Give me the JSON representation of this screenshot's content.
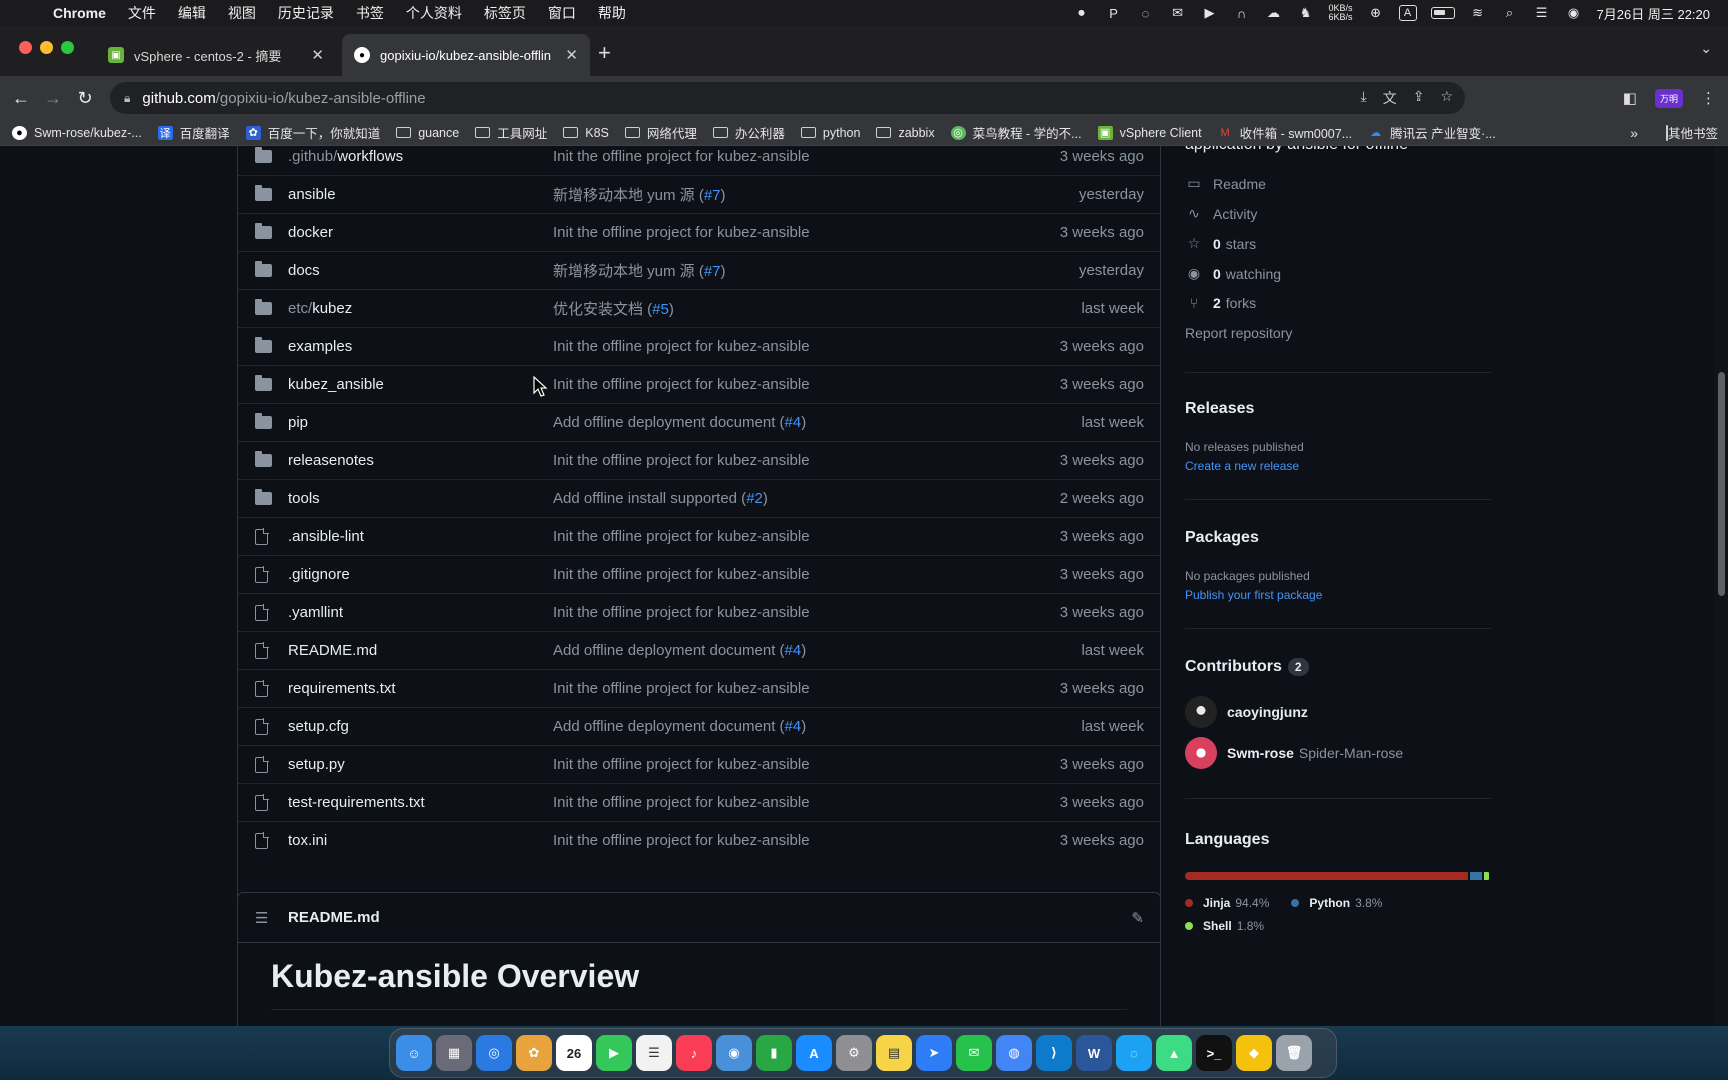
{
  "menubar": {
    "app_name": "Chrome",
    "menus": [
      "文件",
      "编辑",
      "视图",
      "历史记录",
      "书签",
      "个人资料",
      "标签页",
      "窗口",
      "帮助"
    ],
    "net_up": "0KB/s",
    "net_down": "6KB/s",
    "input_method": "A",
    "datetime": "7月26日 周三 22:20"
  },
  "tabs": [
    {
      "title": "vSphere - centos-2 - 摘要",
      "active": false
    },
    {
      "title": "gopixiu-io/kubez-ansible-offlin",
      "active": true
    }
  ],
  "omnibox": {
    "host": "github.com",
    "path": "/gopixiu-io/kubez-ansible-offline"
  },
  "profile_label": "万明",
  "bookmarks": [
    {
      "label": "Swm-rose/kubez-...",
      "icon": "github-icon"
    },
    {
      "label": "百度翻译",
      "icon": "translate-icon"
    },
    {
      "label": "百度一下，你就知道",
      "icon": "baidu-icon"
    },
    {
      "label": "guance",
      "icon": "folder-icon"
    },
    {
      "label": "工具网址",
      "icon": "folder-icon"
    },
    {
      "label": "K8S",
      "icon": "folder-icon"
    },
    {
      "label": "网络代理",
      "icon": "folder-icon"
    },
    {
      "label": "办公利器",
      "icon": "folder-icon"
    },
    {
      "label": "python",
      "icon": "folder-icon"
    },
    {
      "label": "zabbix",
      "icon": "folder-icon"
    },
    {
      "label": "菜鸟教程 - 学的不...",
      "icon": "runoob-icon"
    },
    {
      "label": "vSphere Client",
      "icon": "vsphere-icon"
    },
    {
      "label": "收件箱 - swm0007...",
      "icon": "gmail-icon"
    },
    {
      "label": "腾讯云 产业智变·...",
      "icon": "tencent-cloud-icon"
    }
  ],
  "bookmarks_more": "»",
  "bookmarks_other": "其他书签",
  "files": [
    {
      "type": "dir",
      "prefix": ".github/",
      "name": "workflows",
      "msg": "Init the offline project for kubez-ansible",
      "link": "",
      "time": "3 weeks ago"
    },
    {
      "type": "dir",
      "prefix": "",
      "name": "ansible",
      "msg": "新增移动本地 yum 源 (",
      "link": "#7",
      "time": "yesterday"
    },
    {
      "type": "dir",
      "prefix": "",
      "name": "docker",
      "msg": "Init the offline project for kubez-ansible",
      "link": "",
      "time": "3 weeks ago"
    },
    {
      "type": "dir",
      "prefix": "",
      "name": "docs",
      "msg": "新增移动本地 yum 源 (",
      "link": "#7",
      "time": "yesterday"
    },
    {
      "type": "dir",
      "prefix": "etc/",
      "name": "kubez",
      "msg": "优化安装文档 (",
      "link": "#5",
      "time": "last week"
    },
    {
      "type": "dir",
      "prefix": "",
      "name": "examples",
      "msg": "Init the offline project for kubez-ansible",
      "link": "",
      "time": "3 weeks ago"
    },
    {
      "type": "dir",
      "prefix": "",
      "name": "kubez_ansible",
      "msg": "Init the offline project for kubez-ansible",
      "link": "",
      "time": "3 weeks ago"
    },
    {
      "type": "dir",
      "prefix": "",
      "name": "pip",
      "msg": "Add offline deployment document (",
      "link": "#4",
      "time": "last week"
    },
    {
      "type": "dir",
      "prefix": "",
      "name": "releasenotes",
      "msg": "Init the offline project for kubez-ansible",
      "link": "",
      "time": "3 weeks ago"
    },
    {
      "type": "dir",
      "prefix": "",
      "name": "tools",
      "msg": "Add offline install supported (",
      "link": "#2",
      "time": "2 weeks ago"
    },
    {
      "type": "file",
      "prefix": "",
      "name": ".ansible-lint",
      "msg": "Init the offline project for kubez-ansible",
      "link": "",
      "time": "3 weeks ago"
    },
    {
      "type": "file",
      "prefix": "",
      "name": ".gitignore",
      "msg": "Init the offline project for kubez-ansible",
      "link": "",
      "time": "3 weeks ago"
    },
    {
      "type": "file",
      "prefix": "",
      "name": ".yamllint",
      "msg": "Init the offline project for kubez-ansible",
      "link": "",
      "time": "3 weeks ago"
    },
    {
      "type": "file",
      "prefix": "",
      "name": "README.md",
      "msg": "Add offline deployment document (",
      "link": "#4",
      "time": "last week"
    },
    {
      "type": "file",
      "prefix": "",
      "name": "requirements.txt",
      "msg": "Init the offline project for kubez-ansible",
      "link": "",
      "time": "3 weeks ago"
    },
    {
      "type": "file",
      "prefix": "",
      "name": "setup.cfg",
      "msg": "Add offline deployment document (",
      "link": "#4",
      "time": "last week"
    },
    {
      "type": "file",
      "prefix": "",
      "name": "setup.py",
      "msg": "Init the offline project for kubez-ansible",
      "link": "",
      "time": "3 weeks ago"
    },
    {
      "type": "file",
      "prefix": "",
      "name": "test-requirements.txt",
      "msg": "Init the offline project for kubez-ansible",
      "link": "",
      "time": "3 weeks ago"
    },
    {
      "type": "file",
      "prefix": "",
      "name": "tox.ini",
      "msg": "Init the offline project for kubez-ansible",
      "link": "",
      "time": "3 weeks ago"
    }
  ],
  "readme": {
    "file_label": "README.md",
    "heading": "Kubez-ansible Overview"
  },
  "sidebar": {
    "about_tail": "application by ansible for offline",
    "readme": "Readme",
    "activity": "Activity",
    "stars_count": "0",
    "stars_label": "stars",
    "watching_count": "0",
    "watching_label": "watching",
    "forks_count": "2",
    "forks_label": "forks",
    "report": "Report repository",
    "releases_title": "Releases",
    "releases_empty": "No releases published",
    "releases_link": "Create a new release",
    "packages_title": "Packages",
    "packages_empty": "No packages published",
    "packages_link": "Publish your first package",
    "contributors_title": "Contributors",
    "contributors_count": "2",
    "contributors": [
      {
        "login": "caoyingjunz",
        "alias": ""
      },
      {
        "login": "Swm-rose",
        "alias": "Spider-Man-rose"
      }
    ],
    "languages_title": "Languages",
    "languages": [
      {
        "name": "Jinja",
        "pct": "94.4%",
        "value": 94.4,
        "color": "#a52a22"
      },
      {
        "name": "Python",
        "pct": "3.8%",
        "value": 3.8,
        "color": "#3572A5"
      },
      {
        "name": "Shell",
        "pct": "1.8%",
        "value": 1.8,
        "color": "#89e051"
      }
    ]
  },
  "dock_apps": [
    "finder",
    "launchpad",
    "safari",
    "photos",
    "calendar",
    "facetime",
    "reminders",
    "music",
    "qq-cat",
    "numbers",
    "app-store",
    "system-settings",
    "notes",
    "feishu",
    "wechat",
    "chrome",
    "vscode",
    "word",
    "qq",
    "android-file",
    "terminal",
    "cyberduck",
    "trash"
  ],
  "dock_calendar_day": "26"
}
